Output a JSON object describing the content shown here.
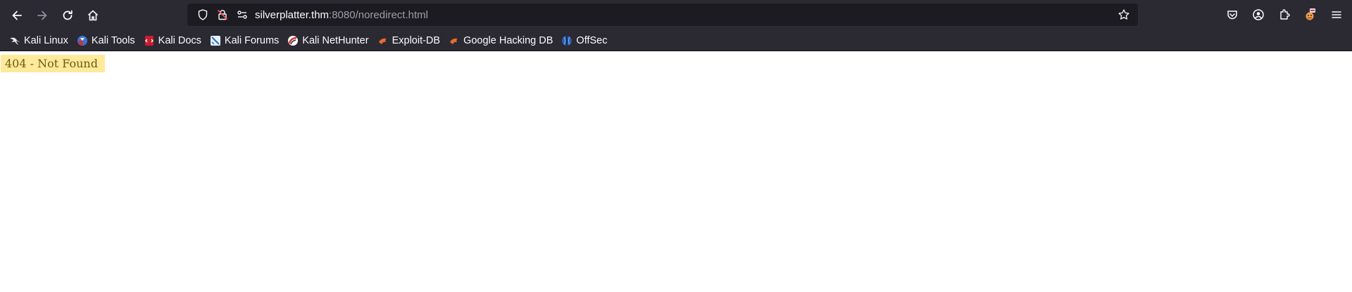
{
  "browser": {
    "url": {
      "host": "silverplatter.thm",
      "rest": ":8080/noredirect.html"
    }
  },
  "bookmarks": [
    {
      "label": "Kali Linux",
      "icon": "kali-dragon-icon"
    },
    {
      "label": "Kali Tools",
      "icon": "kali-tools-icon"
    },
    {
      "label": "Kali Docs",
      "icon": "kali-docs-icon"
    },
    {
      "label": "Kali Forums",
      "icon": "kali-forums-icon"
    },
    {
      "label": "Kali NetHunter",
      "icon": "kali-nethunter-icon"
    },
    {
      "label": "Exploit-DB",
      "icon": "exploit-db-icon"
    },
    {
      "label": "Google Hacking DB",
      "icon": "exploit-db-icon"
    },
    {
      "label": "OffSec",
      "icon": "offsec-icon"
    }
  ],
  "page": {
    "message": "404 - Not Found",
    "highlight_color": "#ffe99a"
  },
  "colors": {
    "toolbar": "#2b2a33",
    "urlbar": "#1c1b22"
  }
}
